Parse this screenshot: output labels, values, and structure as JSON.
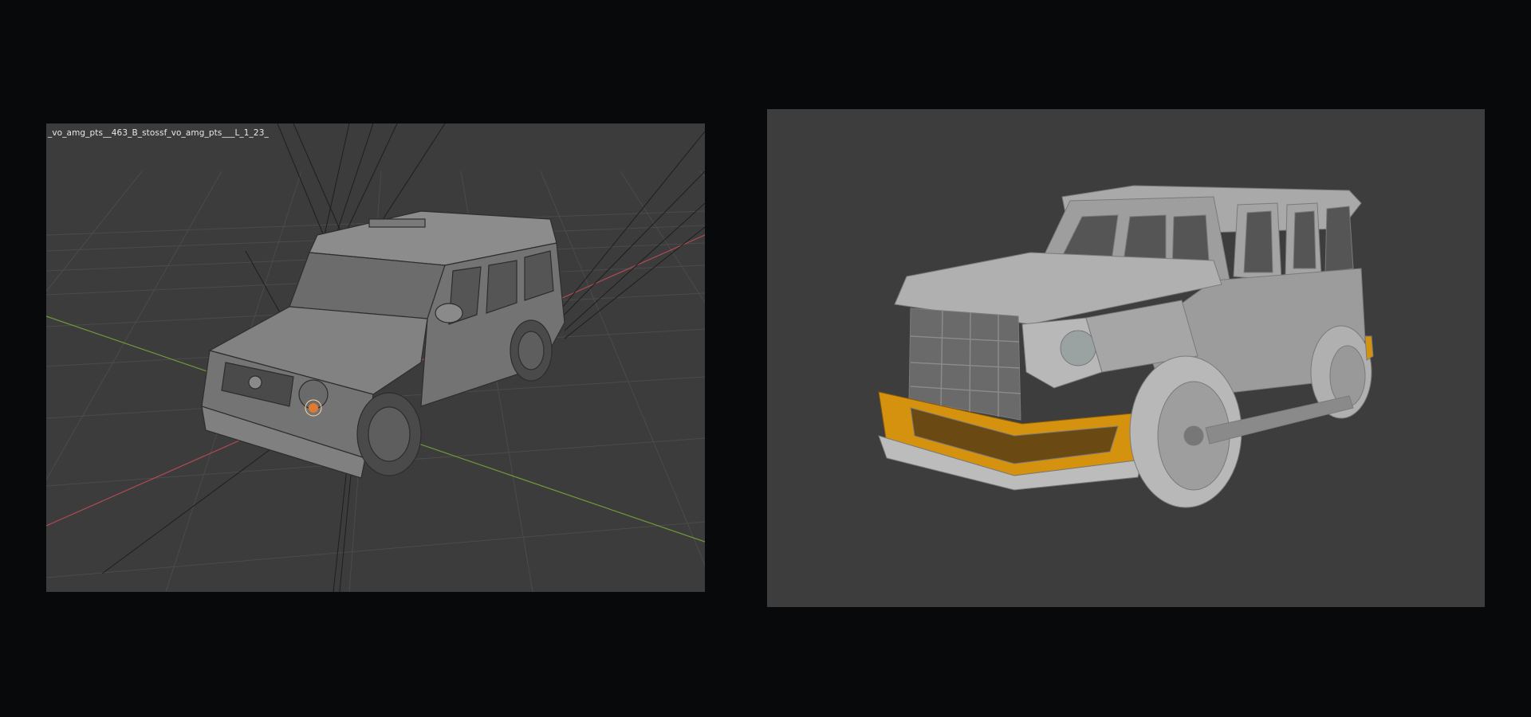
{
  "left_viewport": {
    "object_label": "_vo_amg_pts__463_B_stossf_vo_amg_pts___L_1_23_",
    "colors": {
      "background": "#3c3c3c",
      "grid": "#4a4a4a",
      "x_axis": "#b04a54",
      "y_axis": "#6e9a3a",
      "model": "#8a8a8a"
    },
    "model_icon": "g-wagon-wireframe-model"
  },
  "right_viewport": {
    "colors": {
      "background": "#3d3d3d",
      "model": "#a8a8a8",
      "highlight": "#d4920f"
    },
    "model_icon": "g-wagon-sculpt-model"
  }
}
